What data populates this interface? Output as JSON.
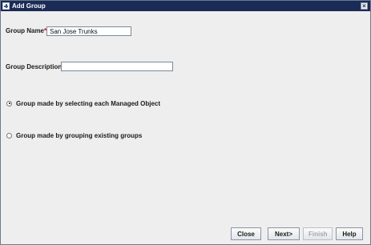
{
  "window": {
    "title": "Add Group"
  },
  "form": {
    "group_name_label": "Group Name",
    "required_marker": "*",
    "group_name_value": "San Jose Trunks",
    "group_description_label": "Group Description",
    "group_description_value": ""
  },
  "options": [
    {
      "label": "Group made by selecting each Managed Object",
      "selected": true
    },
    {
      "label": "Group made by grouping existing groups",
      "selected": false
    }
  ],
  "buttons": {
    "close": "Close",
    "next": "Next>",
    "finish": "Finish",
    "help": "Help"
  },
  "icons": {
    "title": "app-window-icon",
    "close": "close-icon"
  }
}
